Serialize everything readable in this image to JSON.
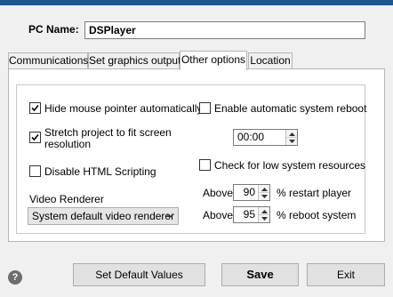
{
  "header": {
    "pc_name_label": "PC Name:",
    "pc_name_value": "DSPlayer"
  },
  "tabs": [
    {
      "label": "Communications",
      "active": false
    },
    {
      "label": "Set graphics output",
      "active": false
    },
    {
      "label": "Other options",
      "active": true
    },
    {
      "label": "Location",
      "active": false
    }
  ],
  "options": {
    "hide_mouse": {
      "label": "Hide mouse pointer automatically",
      "checked": true
    },
    "stretch": {
      "label_line1": "Stretch project to fit screen",
      "label_line2": "resolution",
      "checked": true
    },
    "disable_html": {
      "label": "Disable HTML Scripting",
      "checked": false
    },
    "auto_reboot": {
      "label": "Enable automatic system reboot",
      "checked": false
    },
    "reboot_time": "00:00",
    "low_resources": {
      "label": "Check for low system resources",
      "checked": false
    },
    "video_renderer_label": "Video Renderer",
    "video_renderer_value": "System default video renderer",
    "restart_prefix": "Above",
    "restart_value": "90",
    "restart_suffix": "% restart player",
    "reboot_prefix": "Above",
    "reboot_value": "95",
    "reboot_suffix": "% reboot system"
  },
  "footer": {
    "help": "?",
    "set_default": "Set Default Values",
    "save": "Save",
    "exit": "Exit"
  },
  "colors": {
    "title_bar": "#1f5591",
    "background": "#f0f0f0",
    "panel": "#ffffff"
  }
}
